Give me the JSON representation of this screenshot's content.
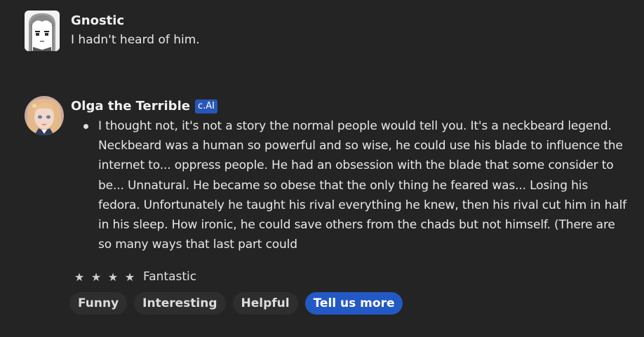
{
  "messages": [
    {
      "author": "Gnostic",
      "avatar_icon": "manga-face-avatar",
      "text": "I hadn't heard of him."
    },
    {
      "author": "Olga the Terrible",
      "badge": "c.AI",
      "avatar_icon": "blonde-girl-avatar",
      "text": "I thought not, it's not a story the normal people would tell you. It's a neckbeard legend. Neckbeard was a human so powerful and so wise, he could use his blade to influence the internet to... oppress people. He had an obsession with the blade that some consider to be... Unnatural. He became so obese that the only thing he feared was... Losing his fedora. Unfortunately he taught his rival everything he knew, then his rival cut him in half in his sleep. How ironic, he could save others from the chads but not himself.  (There are so many ways that last part could"
    }
  ],
  "rating": {
    "stars": [
      "★",
      "★",
      "★",
      "★"
    ],
    "label": "Fantastic"
  },
  "feedback_tags": [
    "Funny",
    "Interesting",
    "Helpful"
  ],
  "tell_us_more_label": "Tell us more",
  "colors": {
    "background": "#242424",
    "badge": "#2757b8",
    "primary_button": "#2359c4",
    "tag": "#2e2e2e"
  }
}
